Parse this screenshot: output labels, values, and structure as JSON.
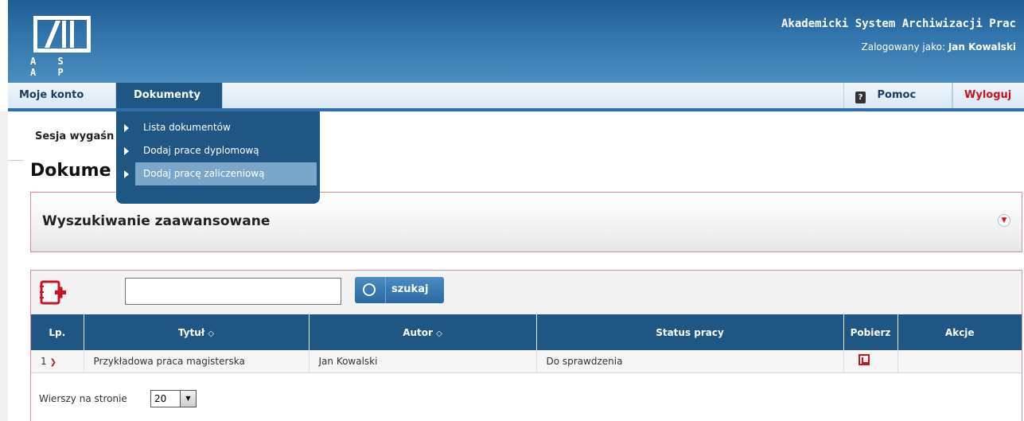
{
  "header": {
    "logo_text": "A S A P",
    "app_title": "Akademicki System Archiwizacji Prac",
    "logged_label": "Zalogowany jako:",
    "user_name": "Jan Kowalski"
  },
  "nav": {
    "items": [
      {
        "label": "Moje konto"
      },
      {
        "label": "Dokumenty"
      }
    ],
    "help": "Pomoc",
    "logout": "Wyloguj"
  },
  "dropdown": {
    "items": [
      {
        "label": "Lista dokumentów"
      },
      {
        "label": "Dodaj prace dyplomową"
      },
      {
        "label": "Dodaj pracę zaliczeniową"
      }
    ]
  },
  "content": {
    "session_text": "Sesja wygaśn",
    "page_title": "Dokume",
    "advanced_search": "Wyszukiwanie zaawansowane"
  },
  "search": {
    "value": "",
    "button_label": "szukaj"
  },
  "table": {
    "headers": [
      "Lp.",
      "Tytuł",
      "Autor",
      "Status pracy",
      "Pobierz",
      "Akcje"
    ],
    "rows": [
      {
        "lp": "1",
        "title": "Przykładowa praca magisterska",
        "author": "Jan Kowalski",
        "status": "Do sprawdzenia"
      }
    ]
  },
  "pager": {
    "rows_label": "Wierszy na stronie",
    "rows_value": "20"
  },
  "colors": {
    "primary": "#1f5684",
    "accent": "#cc1122",
    "header_gradient_top": "#1f5d93"
  }
}
